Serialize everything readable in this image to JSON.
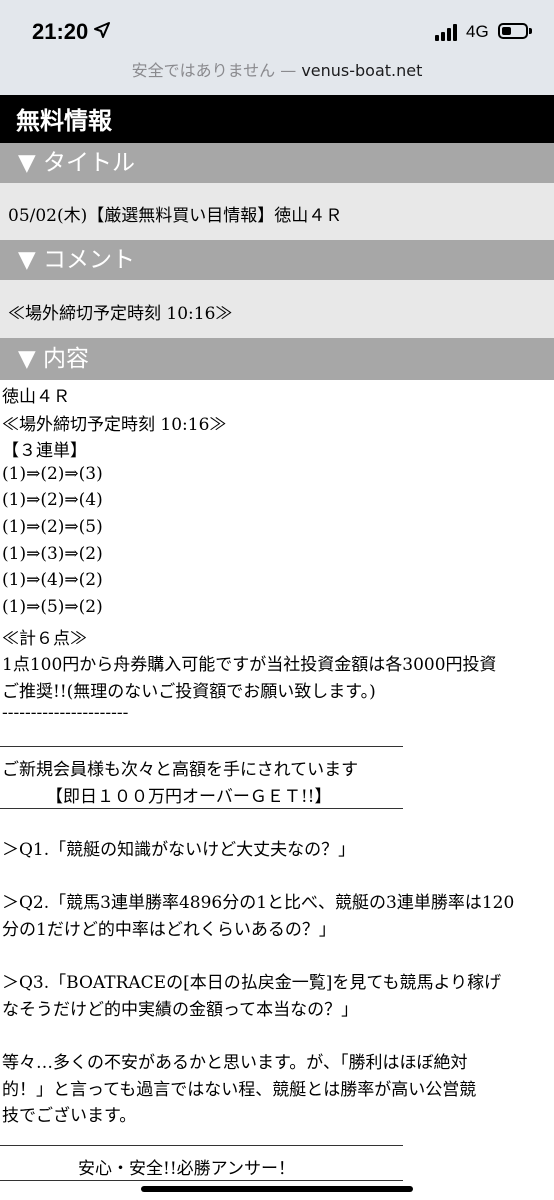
{
  "status": {
    "time": "21:20",
    "network": "4G",
    "battery_level": 0.4
  },
  "urlbar": {
    "prefix": "安全ではありません — ",
    "domain": "venus-boat.net"
  },
  "page_title": "無料情報",
  "sections": {
    "title": {
      "header": "▼ タイトル",
      "body": "05/02(木)【厳選無料買い目情報】徳山４Ｒ"
    },
    "comment": {
      "header": "▼ コメント",
      "body": "≪場外締切予定時刻 10:16≫"
    },
    "content": {
      "header": "▼ 内容"
    }
  },
  "content": {
    "race": "徳山４Ｒ",
    "deadline": "≪場外締切予定時刻 10:16≫",
    "bet_type": "【３連単】",
    "picks": [
      "(1)⇒(2)⇒(3)",
      "(1)⇒(2)⇒(4)",
      "(1)⇒(2)⇒(5)",
      "(1)⇒(3)⇒(2)",
      "(1)⇒(4)⇒(2)",
      "(1)⇒(5)⇒(2)"
    ],
    "total": "≪計６点≫",
    "note_line1": "1点100円から舟券購入可能ですが当社投資金額は各3000円投資",
    "note_line2": "ご推奨!!(無理のないご投資額でお願い致します。)",
    "dashes": "----------------------",
    "promo_line1": "ご新規会員様も次々と高額を手にされています",
    "promo_line2": "【即日１００万円オーバーＧＥＴ!!】",
    "q1": "＞Q1.「競艇の知識がないけど大丈夫なの？」",
    "q2_line1": "＞Q2.「競馬3連単勝率4896分の1と比べ、競艇の3連単勝率は120",
    "q2_line2": "分の1だけど的中率はどれくらいあるの？」",
    "q3_line1": "＞Q3.「BOATRACEの[本日の払戻金一覧]を見ても競馬より稼げ",
    "q3_line2": "なそうだけど的中実績の金額って本当なの？」",
    "closing_line1": "等々…多くの不安があるかと思います。が、「勝利はほぼ絶対",
    "closing_line2": "的！」と言っても過言ではない程、競艇とは勝率が高い公営競",
    "closing_line3": "技でございます。",
    "slogan": "安心・安全!!必勝アンサー！"
  }
}
